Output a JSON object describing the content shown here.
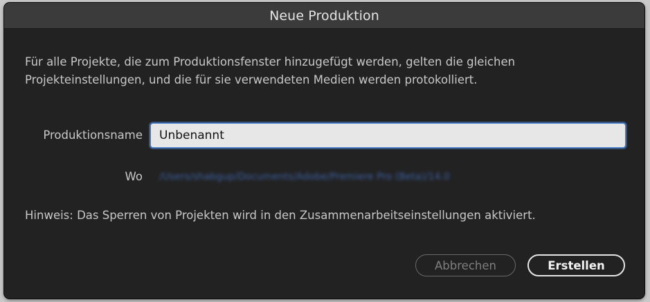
{
  "window": {
    "title": "Neue Produktion"
  },
  "dialog": {
    "description": "Für alle Projekte, die zum Produktionsfenster hinzugefügt werden, gelten die gleichen Projekteinstellungen, und die für sie verwendeten Medien werden protokolliert.",
    "name_label": "Produktionsname",
    "name_value": "Unbenannt",
    "where_label": "Wo",
    "location_path": "/Users/shabgup/Documents/Adobe/Premiere Pro (Beta)/14.0",
    "hint": "Hinweis: Das Sperren von Projekten wird in den Zusammenarbeitseinstellungen aktiviert."
  },
  "buttons": {
    "cancel_label": "Abbrechen",
    "create_label": "Erstellen"
  },
  "colors": {
    "background": "#222222",
    "titlebar": "#3b3b3b",
    "focus_ring": "#4d86d6",
    "text": "#c8c8c8"
  }
}
